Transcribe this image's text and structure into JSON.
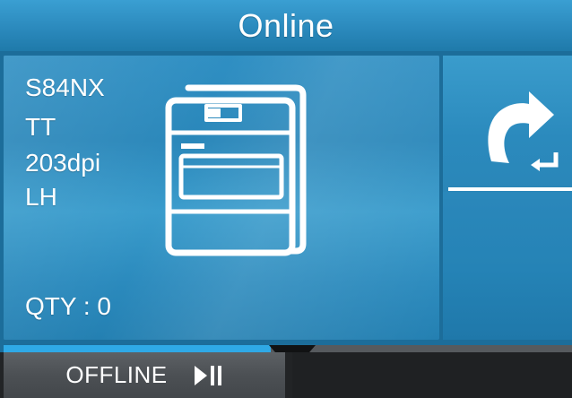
{
  "header": {
    "title": "Online"
  },
  "printer_info": {
    "model": "S84NX",
    "print_method": "TT",
    "resolution": "203dpi",
    "head_side": "LH",
    "quantity_label": "QTY : 0"
  },
  "return_button": {
    "icon": "return-arrow-icon"
  },
  "progress": {
    "fill_fraction": 0.47
  },
  "softkey": {
    "label": "OFFLINE",
    "icon": "play-pause-icon"
  },
  "colors": {
    "accent": "#2fa9e6",
    "panel": "#2a88bb",
    "text": "#ffffff"
  }
}
